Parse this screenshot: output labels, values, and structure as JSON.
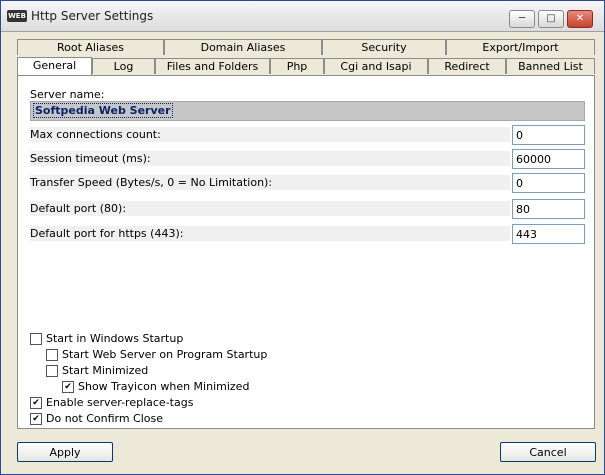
{
  "window": {
    "title": "Http Server Settings",
    "app_icon_text": "WEB"
  },
  "title_buttons": {
    "minimize": "─",
    "maximize": "□",
    "close": "✕"
  },
  "tabs_back": [
    "Root Aliases",
    "Domain Aliases",
    "Security",
    "Export/Import"
  ],
  "tabs_front": [
    "General",
    "Log",
    "Files and Folders",
    "Php",
    "Cgi and Isapi",
    "Redirect",
    "Banned List"
  ],
  "active_tab": "General",
  "general": {
    "server_name_label": "Server name:",
    "server_name_value": "Softpedia Web Server",
    "fields": [
      {
        "label": "Max connections count:",
        "value": "0"
      },
      {
        "label": "Session timeout (ms):",
        "value": "60000"
      },
      {
        "label": "Transfer Speed (Bytes/s, 0 = No Limitation):",
        "value": "0"
      },
      {
        "label": "Default port (80):",
        "value": "80"
      },
      {
        "label": "Default port for https (443):",
        "value": "443"
      }
    ],
    "checkboxes": [
      {
        "label": "Start in Windows Startup",
        "checked": false
      },
      {
        "label": "Start Web Server on Program Startup",
        "checked": false
      },
      {
        "label": "Start Minimized",
        "checked": false
      },
      {
        "label": "Show Trayicon when Minimized",
        "checked": true
      },
      {
        "label": "Enable server-replace-tags",
        "checked": true
      },
      {
        "label": "Do not Confirm Close",
        "checked": true
      }
    ]
  },
  "buttons": {
    "apply": "Apply",
    "cancel": "Cancel"
  },
  "colors": {
    "title_bar": "#dcdcdc",
    "dialog_bg": "#ece9d8",
    "selected_text": "#0a246a"
  }
}
